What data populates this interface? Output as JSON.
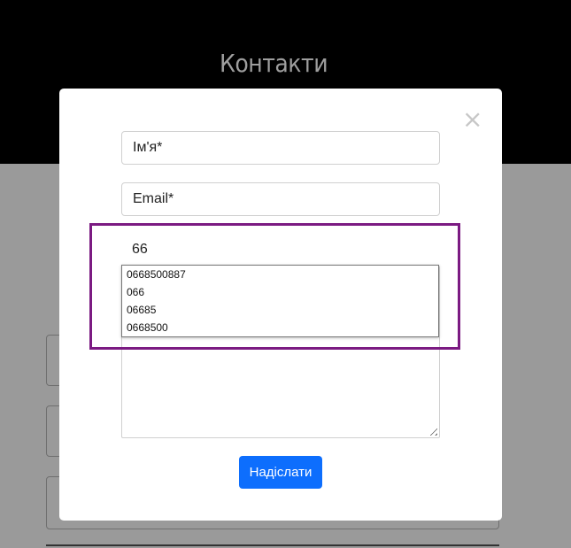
{
  "page": {
    "heading": "Контакти"
  },
  "modal": {
    "close_icon": "×",
    "name_placeholder": "Ім'я*",
    "email_placeholder": "Email*",
    "phone_value": "66",
    "submit_label": "Надіслати"
  },
  "autocomplete": {
    "items": [
      "0668500887",
      "066",
      "06685",
      "0668500"
    ]
  },
  "colors": {
    "accent": "#0d6efd",
    "highlight": "#7b1a82",
    "overlay": "#9a9a9a"
  }
}
